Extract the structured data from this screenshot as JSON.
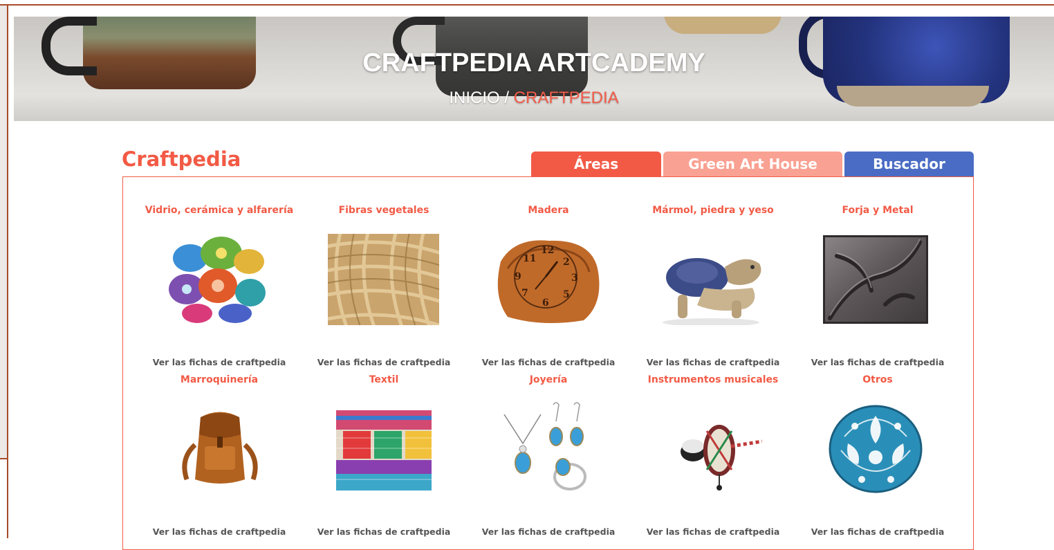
{
  "header": {
    "title": "CRAFTPEDIA ARTCADEMY",
    "breadcrumb": {
      "home": "INICIO",
      "separator": " / ",
      "current": "CRAFTPEDIA"
    }
  },
  "section": {
    "title": "Craftpedia"
  },
  "tabs": [
    {
      "label": "Áreas"
    },
    {
      "label": "Green Art House"
    },
    {
      "label": "Buscador"
    }
  ],
  "categories": [
    {
      "title": "Vidrio, cerámica y alfarería",
      "link": "Ver las fichas de craftpedia",
      "image": "mosaic-stones-image"
    },
    {
      "title": "Fibras vegetales",
      "link": "Ver las fichas de craftpedia",
      "image": "jute-fiber-image"
    },
    {
      "title": "Madera",
      "link": "Ver las fichas de craftpedia",
      "image": "wood-clock-image"
    },
    {
      "title": "Mármol, piedra y yeso",
      "link": "Ver las fichas de craftpedia",
      "image": "stone-turtle-image"
    },
    {
      "title": "Forja y Metal",
      "link": "Ver las fichas de craftpedia",
      "image": "wrought-iron-image"
    },
    {
      "title": "Marroquinería",
      "link": "Ver las fichas de craftpedia",
      "image": "leather-backpack-image"
    },
    {
      "title": "Textil",
      "link": "Ver las fichas de craftpedia",
      "image": "textiles-image"
    },
    {
      "title": "Joyería",
      "link": "Ver las fichas de craftpedia",
      "image": "jewelry-set-image"
    },
    {
      "title": "Instrumentos musicales",
      "link": "Ver las fichas de craftpedia",
      "image": "drum-instrument-image"
    },
    {
      "title": "Otros",
      "link": "Ver las fichas de craftpedia",
      "image": "painted-gourd-image"
    }
  ],
  "colors": {
    "accent": "#f25a45",
    "tab_secondary": "#f9a192",
    "tab_search": "#4a6cc4",
    "frame": "#a84a2a"
  }
}
